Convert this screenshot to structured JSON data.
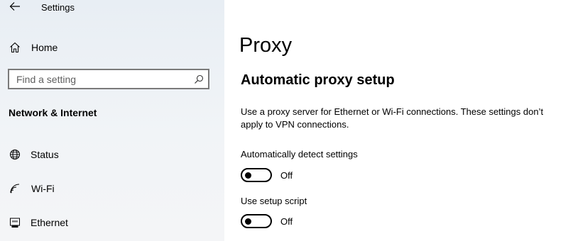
{
  "window": {
    "title": "Settings"
  },
  "sidebar": {
    "home_label": "Home",
    "search": {
      "placeholder": "Find a setting",
      "value": ""
    },
    "section_heading": "Network & Internet",
    "items": [
      {
        "label": "Status",
        "icon": "globe-icon"
      },
      {
        "label": "Wi-Fi",
        "icon": "wifi-icon"
      },
      {
        "label": "Ethernet",
        "icon": "ethernet-icon"
      }
    ]
  },
  "main": {
    "title": "Proxy",
    "automatic_setup": {
      "heading": "Automatic proxy setup",
      "description": "Use a proxy server for Ethernet or Wi-Fi connections. These settings don’t apply to VPN connections.",
      "settings": [
        {
          "label": "Automatically detect settings",
          "state": "Off",
          "on": false
        },
        {
          "label": "Use setup script",
          "state": "Off",
          "on": false
        }
      ]
    }
  }
}
